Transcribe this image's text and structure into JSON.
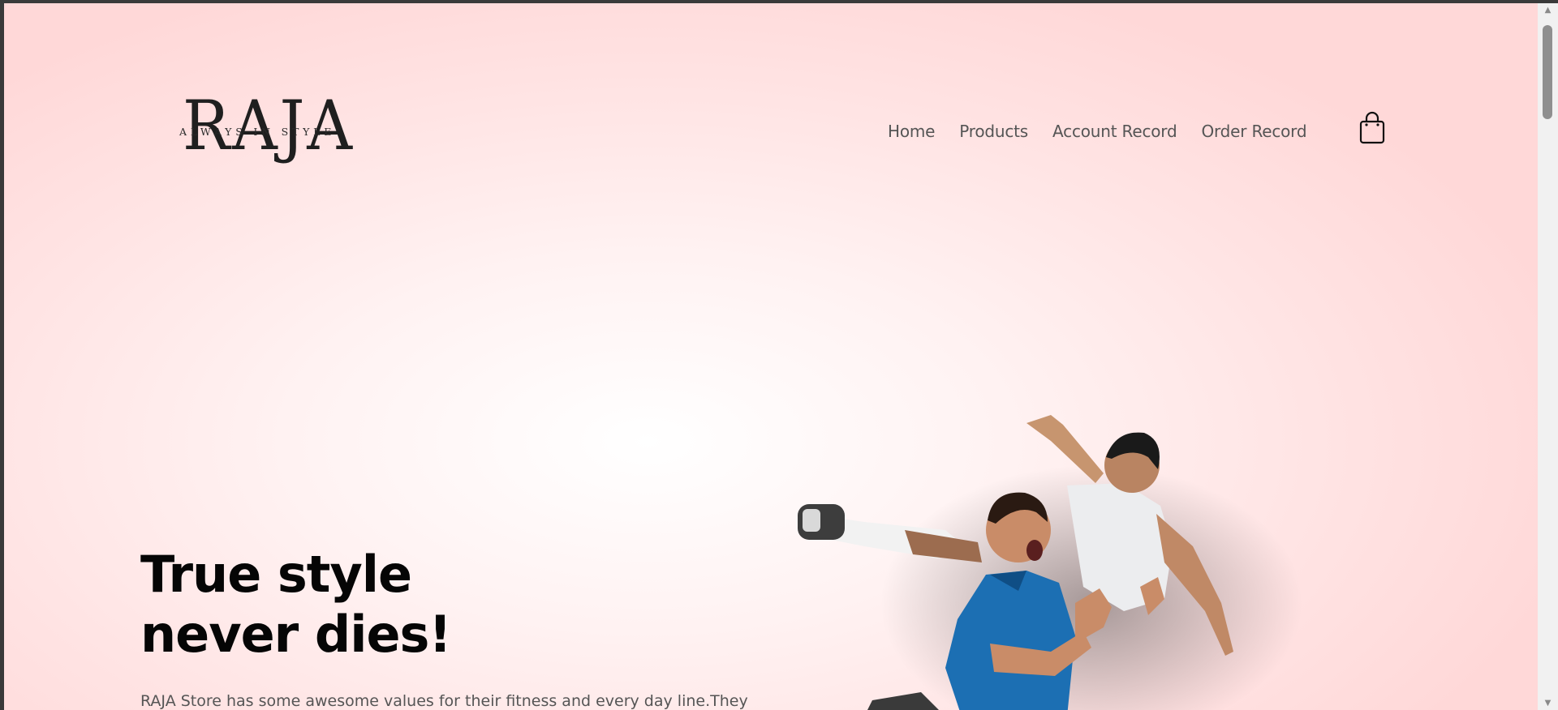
{
  "logo": {
    "text": "RAJA",
    "tagline": "ALWAYS IN STYLE"
  },
  "nav": {
    "items": [
      {
        "label": "Home"
      },
      {
        "label": "Products"
      },
      {
        "label": "Account Record"
      },
      {
        "label": "Order Record"
      }
    ],
    "cart_icon": "shopping-bag-icon"
  },
  "hero": {
    "title_line1": "True style",
    "title_line2": "never dies!",
    "description": "RAJA Store has some awesome values for their fitness and every day line.They",
    "image": "two-soccer-players-celebrating"
  },
  "colors": {
    "background": "#ffe4e4",
    "title": "#050505",
    "nav_text": "#555555"
  }
}
